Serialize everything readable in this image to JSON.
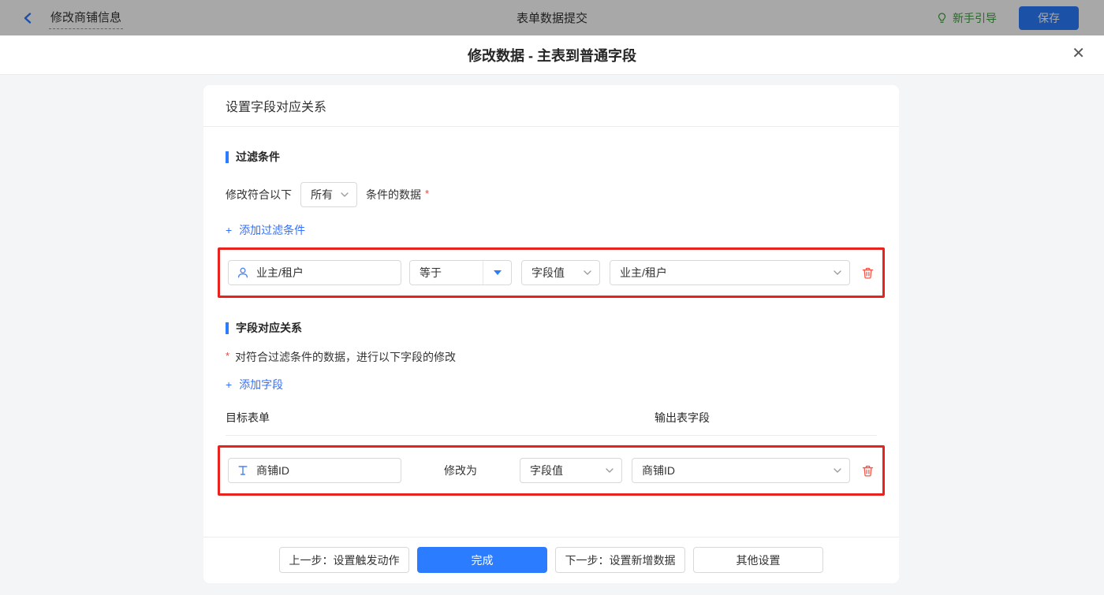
{
  "colors": {
    "accent_blue": "#2b7cff",
    "link_blue": "#3370ff",
    "highlight_red": "#e8221c",
    "trash_red": "#f2564a",
    "guide_green": "#3da13c",
    "asterisk_red": "#f0413e"
  },
  "symbols": {
    "plus": "+",
    "asterisk": "*"
  },
  "topbar": {
    "back_title": "修改商铺信息",
    "center_title": "表单数据提交",
    "guide_label": "新手引导",
    "save_label": "保存"
  },
  "modal": {
    "title": "修改数据 - 主表到普通字段",
    "close_glyph": "✕"
  },
  "panel": {
    "title": "设置字段对应关系",
    "filter_section": {
      "title": "过滤条件",
      "condition_prefix": "修改符合以下",
      "condition_select_value": "所有",
      "condition_suffix": "条件的数据",
      "add_link": "添加过滤条件",
      "row": {
        "field_value": "业主/租户",
        "operator_value": "等于",
        "value_type": "字段值",
        "value_field": "业主/租户"
      }
    },
    "mapping_section": {
      "title": "字段对应关系",
      "description": "对符合过滤条件的数据，进行以下字段的修改",
      "add_link": "添加字段",
      "col_target": "目标表单",
      "col_output": "输出表字段",
      "row": {
        "target_field": "商铺ID",
        "action_label": "修改为",
        "value_type": "字段值",
        "value_field": "商铺ID"
      }
    },
    "footer": {
      "prev_label": "上一步：设置触发动作",
      "done_label": "完成",
      "next_label": "下一步：设置新增数据",
      "other_label": "其他设置"
    }
  }
}
